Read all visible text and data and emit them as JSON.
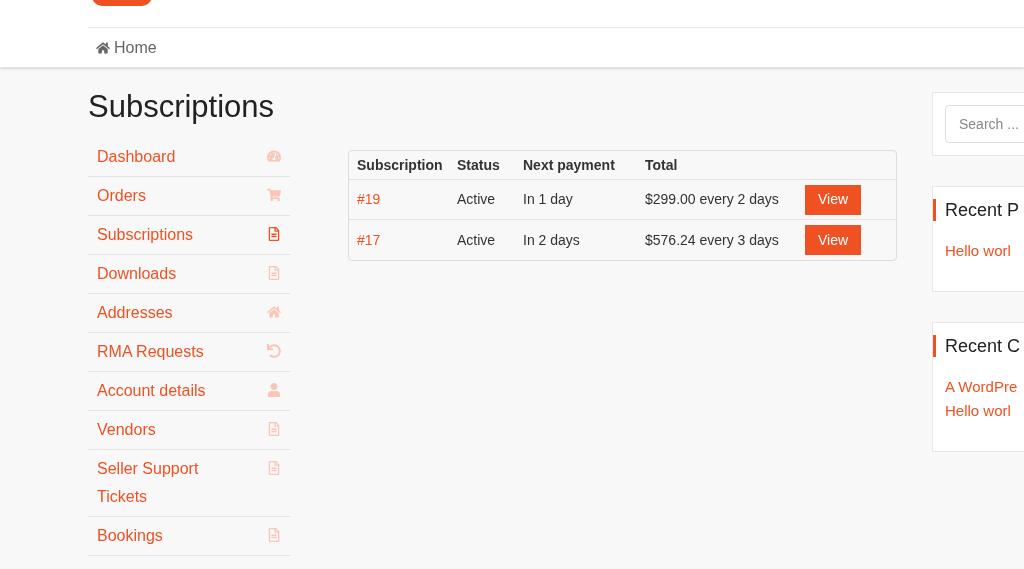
{
  "breadcrumb": {
    "label": "Home"
  },
  "page_title": "Subscriptions",
  "account_nav": [
    {
      "label": "Dashboard",
      "selected": false
    },
    {
      "label": "Orders",
      "selected": false
    },
    {
      "label": "Subscriptions",
      "selected": true
    },
    {
      "label": "Downloads",
      "selected": false
    },
    {
      "label": "Addresses",
      "selected": false
    },
    {
      "label": "RMA Requests",
      "selected": false
    },
    {
      "label": "Account details",
      "selected": false
    },
    {
      "label": "Vendors",
      "selected": false
    },
    {
      "label": "Seller Support Tickets",
      "selected": false
    },
    {
      "label": "Bookings",
      "selected": false
    }
  ],
  "table": {
    "columns": [
      "Subscription",
      "Status",
      "Next payment",
      "Total"
    ],
    "rows": [
      {
        "subscription": "#19",
        "status": "Active",
        "next_payment": "In 1 day",
        "total": "$299.00 every 2 days",
        "action": "View"
      },
      {
        "subscription": "#17",
        "status": "Active",
        "next_payment": "In 2 days",
        "total": "$576.24 every 3 days",
        "action": "View"
      }
    ]
  },
  "sidebar": {
    "search": {
      "placeholder": "Search ..."
    },
    "widgets": [
      {
        "title": "Recent P",
        "links": [
          "Hello worl"
        ]
      },
      {
        "title": "Recent C",
        "links": [
          "A WordPre",
          "Hello worl"
        ]
      }
    ]
  }
}
